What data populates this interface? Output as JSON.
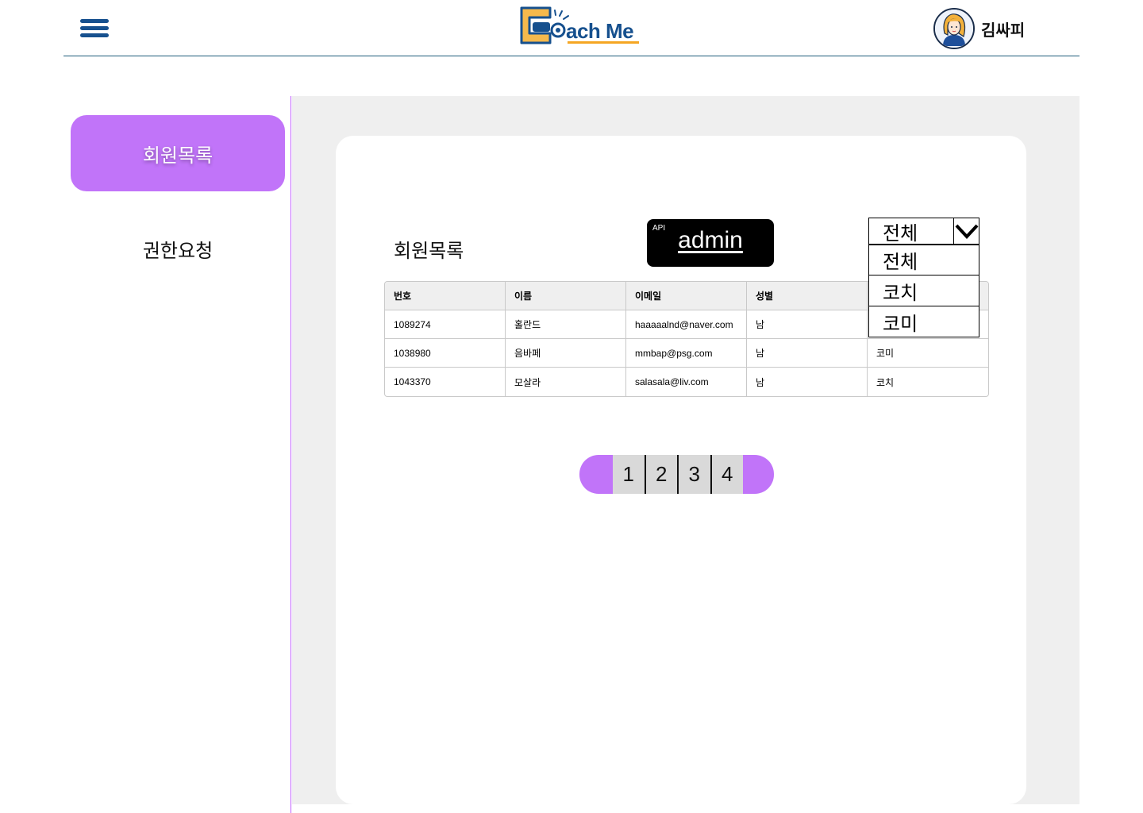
{
  "header": {
    "logo_text": "ach Me",
    "user_name": "김싸피"
  },
  "sidebar": {
    "items": [
      {
        "label": "회원목록"
      },
      {
        "label": "권한요청"
      }
    ]
  },
  "main": {
    "heading": "회원목록",
    "api_badge": {
      "small": "API",
      "label": "admin"
    },
    "filter": {
      "selected": "전체",
      "options": [
        "전체",
        "코치",
        "코미"
      ]
    },
    "table": {
      "columns": [
        "번호",
        "이름",
        "이메일",
        "성별",
        ""
      ],
      "rows": [
        [
          "1089274",
          "홀란드",
          "haaaaalnd@naver.com",
          "남",
          ""
        ],
        [
          "1038980",
          "음바페",
          "mmbap@psg.com",
          "남",
          "코미"
        ],
        [
          "1043370",
          "모살라",
          "salasala@liv.com",
          "남",
          "코치"
        ]
      ]
    },
    "pagination": [
      "1",
      "2",
      "3",
      "4"
    ]
  },
  "colors": {
    "accent": "#c174f9",
    "brand": "#16508e",
    "logo_accent": "#f5a623"
  }
}
